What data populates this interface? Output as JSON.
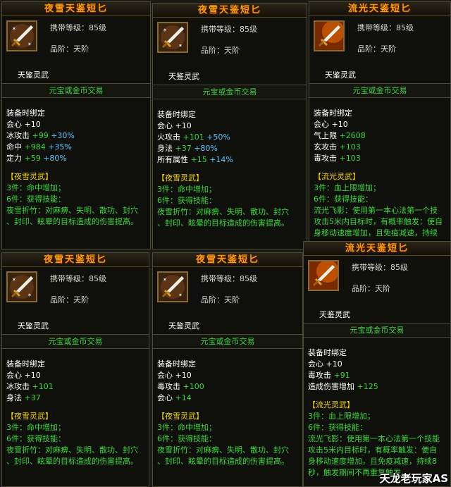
{
  "watermark": "天龙老玩家AS",
  "common": {
    "level": "携带等级：85级",
    "grade": "品阶：天阶",
    "trade": "元宝或金币交易",
    "bind": "装备时绑定"
  },
  "cards": [
    {
      "title": "夜雪天鉴短匕",
      "subname": "天鉴灵武",
      "icon": "dagger-icon-snow",
      "stats": [
        {
          "t": "会心 +10"
        },
        {
          "t": "冰攻击 ",
          "v": "+99",
          "e": "+30%"
        },
        {
          "t": "命中 ",
          "v": "+984",
          "e": "+35%"
        },
        {
          "t": "定力 ",
          "v": "+59",
          "e": "+80%"
        }
      ],
      "set_title": "【夜雪灵武】",
      "set3": "3件：命中增加；",
      "set6": "6件：获得技能：",
      "skill": [
        "夜雪折竹：对麻痹、失明、散功、封穴",
        "、封印、眩晕的目标造成的伤害提高。"
      ]
    },
    {
      "title": "夜雪天鉴短匕",
      "subname": "天鉴灵武",
      "icon": "dagger-icon-snow",
      "stats": [
        {
          "t": "会心 +10"
        },
        {
          "t": "火攻击 ",
          "v": "+101",
          "e": "+50%"
        },
        {
          "t": "身法 ",
          "v": "+37",
          "e": "+80%"
        },
        {
          "t": "所有属性 ",
          "v": "+15",
          "e": "+14%"
        }
      ],
      "set_title": "【夜雪灵武】",
      "set3": "3件：命中增加；",
      "set6": "6件：获得技能：",
      "skill": [
        "夜雪折竹：对麻痹、失明、散功、封穴",
        "、封印、眩晕的目标造成的伤害提高。"
      ]
    },
    {
      "title": "流光天鉴短匕",
      "subname": "天鉴灵武",
      "icon": "dagger-icon-fire",
      "stats": [
        {
          "t": "会心 +10"
        },
        {
          "t": "气上限 ",
          "v": "+2608"
        },
        {
          "t": "玄攻击 ",
          "v": "+103"
        },
        {
          "t": "毒攻击 ",
          "v": "+103"
        }
      ],
      "set_title": "【流光灵武】",
      "set3": "3件：血上限增加；",
      "set6": "6件：获得技能：",
      "skill": [
        "流光飞影：使用第一本心法第一个技",
        "攻击5米内目标时，有概率触发：使自",
        "身移动速度增加，且免疫减速，持续"
      ]
    },
    {
      "title": "夜雪天鉴短匕",
      "subname": "天鉴灵武",
      "icon": "dagger-icon-snow",
      "stats": [
        {
          "t": "会心 +10"
        },
        {
          "t": "冰攻击 ",
          "v": "+101"
        },
        {
          "t": "身法 ",
          "v": "+37"
        }
      ],
      "set_title": "【夜雪灵武】",
      "set3": "3件：命中增加；",
      "set6": "6件：获得技能：",
      "skill": [
        "夜雪折竹：对麻痹、失明、散功、封穴",
        "、封印、眩晕的目标造成的伤害提高。"
      ]
    },
    {
      "title": "夜雪天鉴短匕",
      "subname": "天鉴灵武",
      "icon": "dagger-icon-snow",
      "stats": [
        {
          "t": "会心 +10"
        },
        {
          "t": "毒攻击 ",
          "v": "+100"
        },
        {
          "t": "会心 ",
          "v": "+14"
        }
      ],
      "set_title": "【夜雪灵武】",
      "set3": "3件：命中增加；",
      "set6": "6件：获得技能：",
      "skill": [
        "夜雪折竹：对麻痹、失明、散功、封穴",
        "、封印、眩晕的目标造成的伤害提高。"
      ]
    },
    {
      "title": "流光天鉴短匕",
      "subname": "天鉴灵武",
      "icon": "dagger-icon-fire",
      "stats": [
        {
          "t": "会心 +10"
        },
        {
          "t": "毒攻击 ",
          "v": "+91"
        },
        {
          "t": "造成伤害增加 ",
          "v": "+125"
        }
      ],
      "set_title": "【流光灵武】",
      "set3": "3件：血上限增加；",
      "set6": "6件：获得技能：",
      "skill": [
        "流光飞影：使用第一本心法第一个技能",
        "攻击5米内目标时，有概率触发：使自",
        "身移动速度增加，且免疫减速，持续8",
        "秒，触发期间不再重复触发。"
      ]
    }
  ]
}
